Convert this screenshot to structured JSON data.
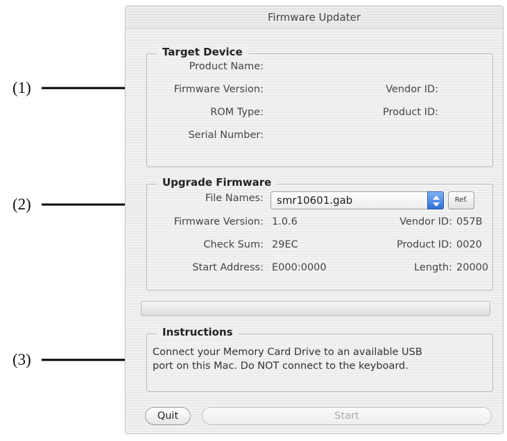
{
  "callouts": [
    "(1)",
    "(2)",
    "(3)"
  ],
  "window": {
    "title": "Firmware Updater"
  },
  "target_device": {
    "legend": "Target Device",
    "product_name_label": "Product Name:",
    "firmware_version_label": "Firmware Version:",
    "vendor_id_label": "Vendor ID:",
    "rom_type_label": "ROM Type:",
    "product_id_label": "Product ID:",
    "serial_number_label": "Serial Number:"
  },
  "upgrade_firmware": {
    "legend": "Upgrade Firmware",
    "file_names_label": "File Names:",
    "file_selected": "smr10601.gab",
    "ref_label": "Ref.",
    "firmware_version_label": "Firmware Version:",
    "firmware_version_value": "1.0.6",
    "vendor_id_label": "Vendor ID:",
    "vendor_id_value": "057B",
    "check_sum_label": "Check Sum:",
    "check_sum_value": "29EC",
    "product_id_label": "Product ID:",
    "product_id_value": "0020",
    "start_address_label": "Start Address:",
    "start_address_value": "E000:0000",
    "length_label": "Length:",
    "length_value": "20000"
  },
  "progress": {
    "value": 0
  },
  "instructions": {
    "legend": "Instructions",
    "line1": "Connect your Memory Card Drive to an available USB",
    "line2": "port on this Mac. Do NOT connect to the keyboard."
  },
  "buttons": {
    "quit_label": "Quit",
    "start_label": "Start"
  }
}
